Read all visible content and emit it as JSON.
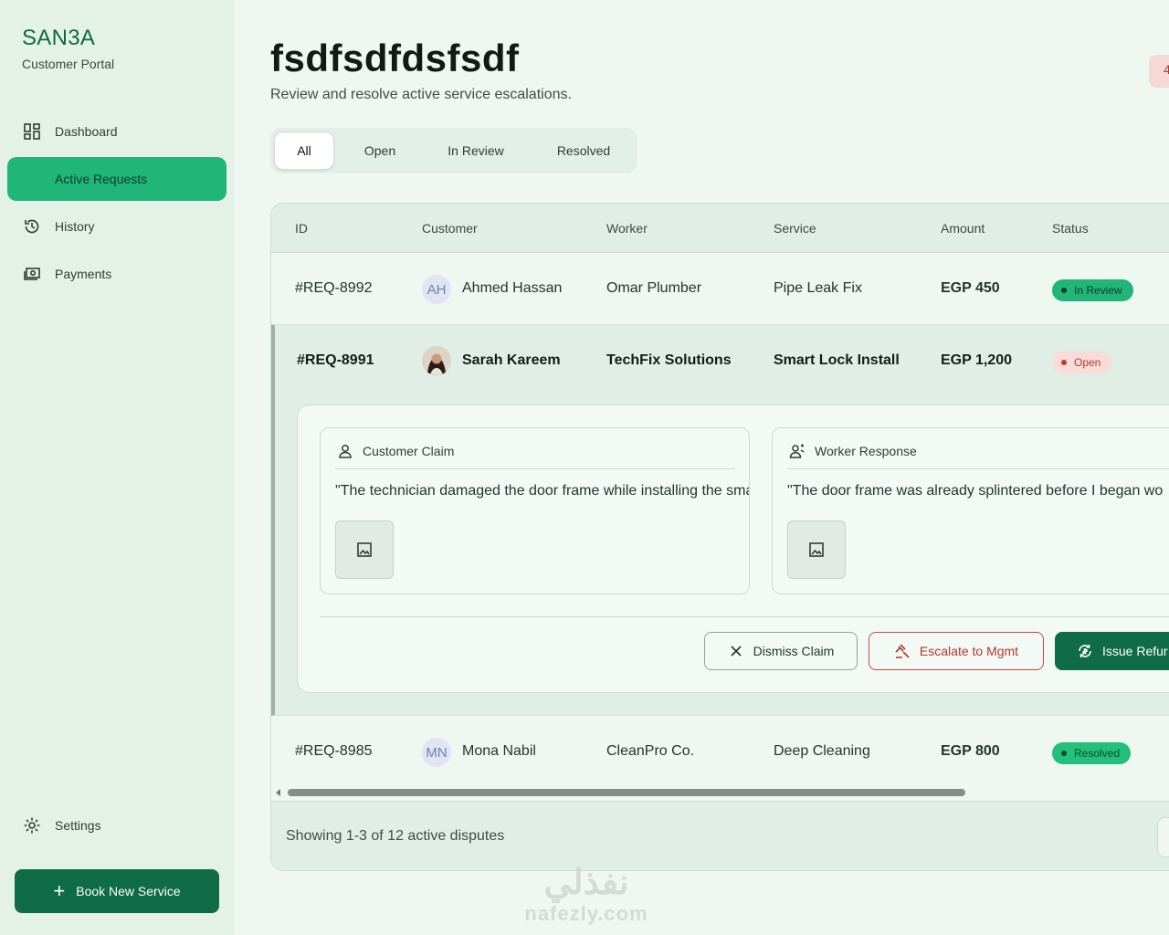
{
  "brand": {
    "name": "SAN3A",
    "subtitle": "Customer Portal"
  },
  "sidebar": {
    "items": [
      {
        "label": "Dashboard",
        "icon": "dashboard-icon"
      },
      {
        "label": "Active Requests",
        "icon": "none",
        "active": true
      },
      {
        "label": "History",
        "icon": "history-icon"
      },
      {
        "label": "Payments",
        "icon": "payments-icon"
      }
    ],
    "settings": {
      "label": "Settings",
      "icon": "gear-icon"
    },
    "book_button": {
      "label": "Book New Service",
      "icon": "plus-icon"
    }
  },
  "header": {
    "title": "fsdfsdfdsfsdf",
    "subtitle": "Review and resolve active service escalations.",
    "corner_badge": "4"
  },
  "tabs": [
    {
      "label": "All",
      "active": true
    },
    {
      "label": "Open"
    },
    {
      "label": "In Review"
    },
    {
      "label": "Resolved"
    }
  ],
  "table": {
    "columns": [
      "ID",
      "Customer",
      "Worker",
      "Service",
      "Amount",
      "Status"
    ],
    "rows": [
      {
        "id": "#REQ-8992",
        "initials": "AH",
        "customer": "Ahmed Hassan",
        "worker": "Omar Plumber",
        "service": "Pipe Leak Fix",
        "amount": "EGP 450",
        "status": "In Review"
      },
      {
        "id": "#REQ-8991",
        "initials": "",
        "customer": "Sarah Kareem",
        "worker": "TechFix Solutions",
        "service": "Smart Lock Install",
        "amount": "EGP 1,200",
        "status": "Open"
      },
      {
        "id": "#REQ-8985",
        "initials": "MN",
        "customer": "Mona Nabil",
        "worker": "CleanPro Co.",
        "service": "Deep Cleaning",
        "amount": "EGP 800",
        "status": "Resolved"
      }
    ],
    "detail": {
      "customer_claim": {
        "title": "Customer Claim",
        "text": "\"The technician damaged the door frame while installing the smar"
      },
      "worker_response": {
        "title": "Worker Response",
        "text": "\"The door frame was already splintered before I began wo"
      },
      "actions": {
        "dismiss": "Dismiss Claim",
        "escalate": "Escalate to Mgmt",
        "refund": "Issue Refur"
      }
    },
    "footer": "Showing 1-3 of 12 active disputes"
  },
  "watermark": {
    "arabic": "نفذلي",
    "latin": "nafezly.com"
  },
  "colors": {
    "accent": "#20b67a",
    "primary_dark": "#0f6b48",
    "danger": "#c9473c",
    "background": "#eef8f1"
  }
}
